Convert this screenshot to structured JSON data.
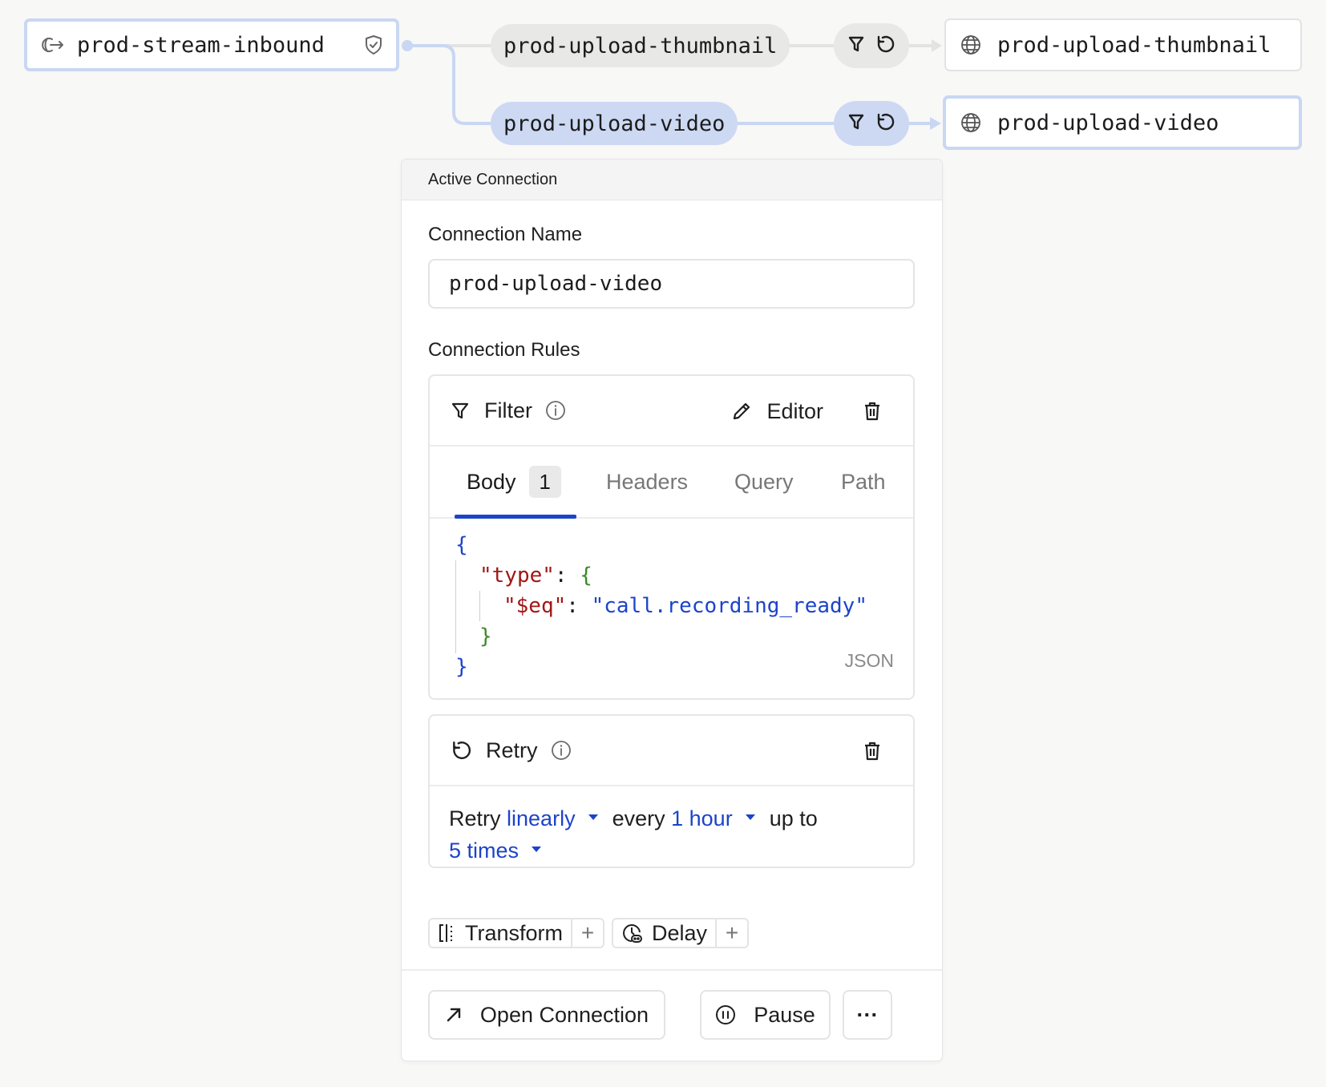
{
  "canvas": {
    "source_node": {
      "label": "prod-stream-inbound",
      "icon": "inbound-stream-icon",
      "badge_icon": "shield-check-icon"
    },
    "connections": [
      {
        "label": "prod-upload-thumbnail",
        "rule_icons": [
          "filter-icon",
          "retry-icon"
        ],
        "destination": "prod-upload-thumbnail",
        "destination_icon": "globe-icon",
        "selected": false
      },
      {
        "label": "prod-upload-video",
        "rule_icons": [
          "filter-icon",
          "retry-icon"
        ],
        "destination": "prod-upload-video",
        "destination_icon": "globe-icon",
        "selected": true
      }
    ],
    "colors": {
      "line_default": "#e3e3e3",
      "line_selected": "#c9d7f2",
      "accent": "#1c44c9"
    }
  },
  "panel": {
    "header": "Active Connection",
    "name_label": "Connection Name",
    "name_value": "prod-upload-video",
    "rules_label": "Connection Rules",
    "filter": {
      "title": "Filter",
      "editor_label": "Editor",
      "tabs": [
        {
          "label": "Body",
          "badge": "1",
          "active": true
        },
        {
          "label": "Headers",
          "active": false
        },
        {
          "label": "Query",
          "active": false
        },
        {
          "label": "Path",
          "active": false
        }
      ],
      "code": {
        "open": "{",
        "key1": "\"type\"",
        "colon": ":",
        "inner_open": "{",
        "key2": "\"$eq\"",
        "value": "\"call.recording_ready\"",
        "inner_close": "}",
        "close": "}"
      },
      "format": "JSON"
    },
    "retry": {
      "title": "Retry",
      "prefix": "Retry",
      "strategy": "linearly",
      "every_label": "every",
      "interval": "1 hour",
      "up_to_label": "up to",
      "count": "5 times"
    },
    "add_rules": [
      {
        "label": "Transform",
        "icon": "transform-icon",
        "plus": "+"
      },
      {
        "label": "Delay",
        "icon": "delay-clock-icon",
        "plus": "+"
      }
    ],
    "footer": {
      "open_label": "Open Connection",
      "pause_label": "Pause",
      "more_label": "···"
    }
  }
}
